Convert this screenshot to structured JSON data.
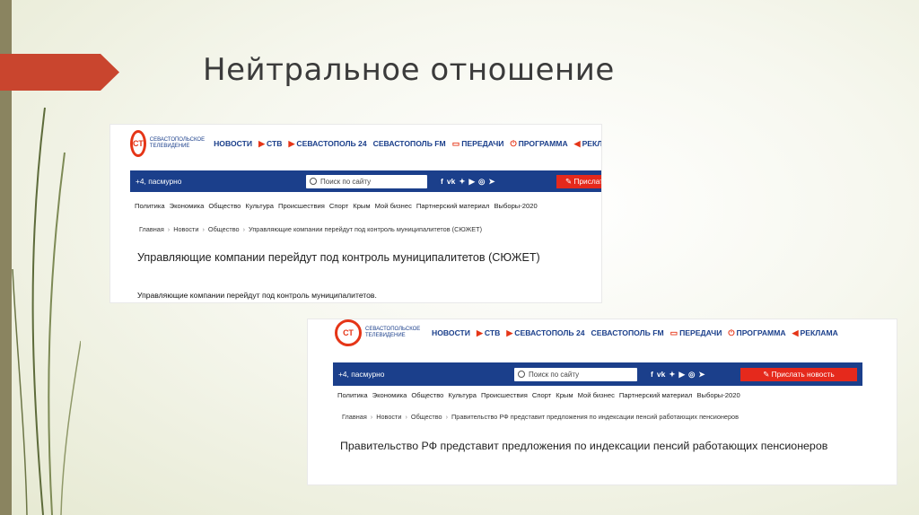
{
  "slide": {
    "title": "Нейтральное отношение"
  },
  "colors": {
    "accent_red": "#c9452e",
    "brand_blue": "#1b3f8b",
    "logo_red": "#e53517"
  },
  "screenshot1": {
    "logo_text": "СЕВАСТОПОЛЬСКОЕ ТЕЛЕВИДЕНИЕ",
    "logo_mark": "СТ",
    "nav": [
      {
        "label": "НОВОСТИ",
        "icon": ""
      },
      {
        "label": "СТВ",
        "icon": "play-icon"
      },
      {
        "label": "СЕВАСТОПОЛЬ 24",
        "icon": "play-icon"
      },
      {
        "label": "СЕВАСТОПОЛЬ FM",
        "icon": ""
      },
      {
        "label": "ПЕРЕДАЧИ",
        "icon": "tv-icon"
      },
      {
        "label": "ПРОГРАММА",
        "icon": "power-icon"
      },
      {
        "label": "РЕКЛАМА",
        "icon": "megaphone-icon"
      }
    ],
    "weather": "+4, пасмурно",
    "search_placeholder": "Поиск по сайту",
    "social": [
      "f",
      "vk",
      "tw",
      "yt",
      "ig",
      "tg"
    ],
    "propose_label": "Прислать",
    "categories": [
      "Политика",
      "Экономика",
      "Общество",
      "Культура",
      "Происшествия",
      "Спорт",
      "Крым",
      "Мой бизнес",
      "Партнерский материал",
      "Выборы-2020"
    ],
    "breadcrumbs": [
      "Главная",
      "Новости",
      "Общество",
      "Управляющие компании перейдут под контроль муниципалитетов (СЮЖЕТ)"
    ],
    "headline": "Управляющие компании перейдут под контроль муниципалитетов (СЮЖЕТ)",
    "lead": "Управляющие компании перейдут под контроль муниципалитетов."
  },
  "screenshot2": {
    "logo_text": "СЕВАСТОПОЛЬСКОЕ ТЕЛЕВИДЕНИЕ",
    "logo_mark": "СТ",
    "nav": [
      {
        "label": "НОВОСТИ",
        "icon": ""
      },
      {
        "label": "СТВ",
        "icon": "play-icon"
      },
      {
        "label": "СЕВАСТОПОЛЬ 24",
        "icon": "play-icon"
      },
      {
        "label": "СЕВАСТОПОЛЬ FM",
        "icon": ""
      },
      {
        "label": "ПЕРЕДАЧИ",
        "icon": "tv-icon"
      },
      {
        "label": "ПРОГРАММА",
        "icon": "power-icon"
      },
      {
        "label": "РЕКЛАМА",
        "icon": "megaphone-icon"
      }
    ],
    "weather": "+4, пасмурно",
    "search_placeholder": "Поиск по сайту",
    "social": [
      "f",
      "vk",
      "tw",
      "yt",
      "ig",
      "tg"
    ],
    "propose_label": "Прислать новость",
    "categories": [
      "Политика",
      "Экономика",
      "Общество",
      "Культура",
      "Происшествия",
      "Спорт",
      "Крым",
      "Мой бизнес",
      "Партнерский материал",
      "Выборы-2020"
    ],
    "breadcrumbs": [
      "Главная",
      "Новости",
      "Общество",
      "Правительство РФ представит предложения по индексации пенсий работающих пенсионеров"
    ],
    "headline": "Правительство РФ представит предложения по индексации пенсий работающих пенсионеров"
  }
}
